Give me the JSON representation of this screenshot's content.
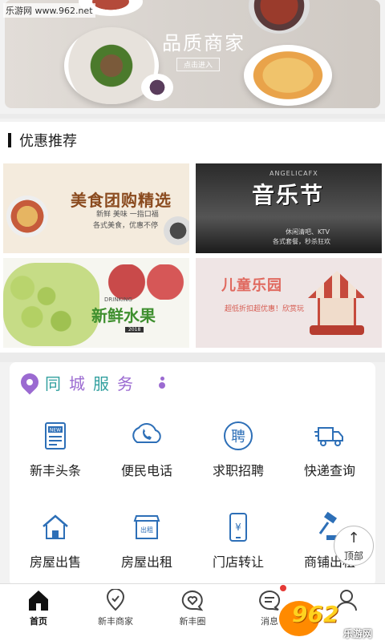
{
  "watermark_top": "乐游网 www.962.net",
  "hero": {
    "title": "品质商家",
    "button_label": "点击进入"
  },
  "promo_section": {
    "title": "优惠推荐"
  },
  "promos": {
    "food": {
      "title": "美食团购精选",
      "line1": "新鲜 美味 一指口福",
      "line2": "各式美食，优惠不停"
    },
    "music": {
      "brand": "ANGELICAFX",
      "title": "音乐节",
      "line1": "休闲清吧、KTV",
      "line2": "各式套餐，秒杀狂欢"
    },
    "fruit": {
      "brand": "DRINKING",
      "title": "新鲜水果",
      "tag": "2018"
    },
    "kids": {
      "title": "儿童乐园",
      "line1": "超低折扣超优惠！欣赏玩"
    }
  },
  "services": {
    "title_chars": [
      "同",
      "城",
      "服",
      "务"
    ],
    "items": [
      {
        "label": "新丰头条",
        "icon": "news-icon"
      },
      {
        "label": "便民电话",
        "icon": "phone-icon"
      },
      {
        "label": "求职招聘",
        "icon": "recruit-icon"
      },
      {
        "label": "快递查询",
        "icon": "delivery-truck-icon"
      },
      {
        "label": "房屋出售",
        "icon": "house-icon"
      },
      {
        "label": "房屋出租",
        "icon": "rent-shop-icon"
      },
      {
        "label": "门店转让",
        "icon": "store-transfer-icon"
      },
      {
        "label": "商铺出租",
        "icon": "auction-gavel-icon"
      }
    ]
  },
  "back_to_top": {
    "label": "顶部"
  },
  "tabbar": {
    "tabs": [
      {
        "label": "首页",
        "icon": "home-icon",
        "active": true
      },
      {
        "label": "新丰商家",
        "icon": "location-icon",
        "active": false
      },
      {
        "label": "新丰圈",
        "icon": "heart-chat-icon",
        "active": false
      },
      {
        "label": "消息",
        "icon": "message-icon",
        "active": false
      },
      {
        "label": "",
        "icon": "user-icon",
        "active": false
      }
    ]
  },
  "watermark_bottom": {
    "logo": "962",
    "sub": "乐游网"
  },
  "colors": {
    "service_teal": "#2f9f9e",
    "service_purple": "#9b6ad1",
    "icon_blue": "#2d6fb7",
    "notify_red": "#e53935"
  }
}
